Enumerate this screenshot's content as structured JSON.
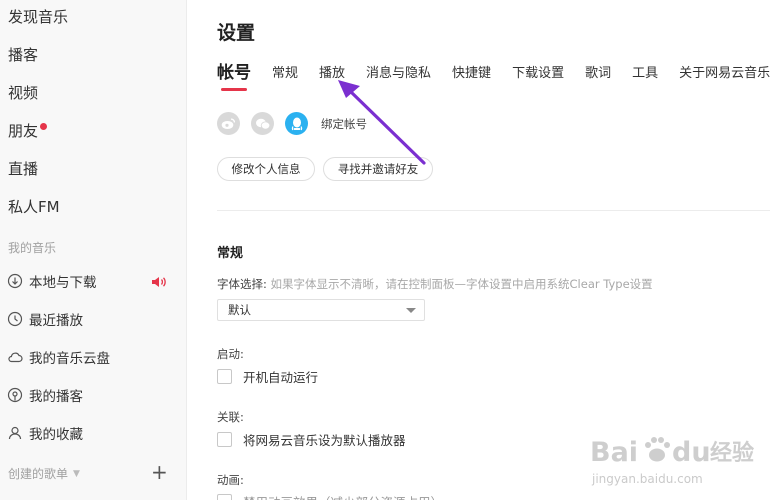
{
  "sidebar": {
    "nav": [
      {
        "label": "发现音乐"
      },
      {
        "label": "播客"
      },
      {
        "label": "视频"
      },
      {
        "label": "朋友",
        "badge_color": "#e5354a"
      },
      {
        "label": "直播"
      },
      {
        "label": "私人FM"
      }
    ],
    "my_music_title": "我的音乐",
    "my_music": [
      {
        "label": "本地与下载",
        "icon": "download-icon",
        "playing_icon": "speaker-icon"
      },
      {
        "label": "最近播放",
        "icon": "clock-icon"
      },
      {
        "label": "我的音乐云盘",
        "icon": "cloud-icon"
      },
      {
        "label": "我的播客",
        "icon": "podcast-icon"
      },
      {
        "label": "我的收藏",
        "icon": "user-icon"
      }
    ],
    "created_playlists_title": "创建的歌单",
    "add_symbol": "+"
  },
  "settings": {
    "title": "设置",
    "tabs": [
      {
        "label": "帐号",
        "active": true
      },
      {
        "label": "常规"
      },
      {
        "label": "播放"
      },
      {
        "label": "消息与隐私"
      },
      {
        "label": "快捷键"
      },
      {
        "label": "下载设置"
      },
      {
        "label": "歌词"
      },
      {
        "label": "工具"
      },
      {
        "label": "关于网易云音乐"
      }
    ],
    "account": {
      "social_icons": [
        "weibo-icon",
        "wechat-icon",
        "qq-icon"
      ],
      "bind_label": "绑定帐号",
      "edit_profile": "修改个人信息",
      "find_friends": "寻找并邀请好友"
    },
    "general": {
      "title": "常规",
      "font_label": "字体选择:",
      "font_hint": "如果字体显示不清晰，请在控制面板—字体设置中启用系统Clear Type设置",
      "font_value": "默认",
      "startup_label": "启动:",
      "startup_option": "开机自动运行",
      "assoc_label": "关联:",
      "assoc_option": "将网易云音乐设为默认播放器",
      "anim_label": "动画:",
      "anim_option": "禁用动画效果（减少部分资源占用）"
    }
  },
  "annotation": {
    "color": "#7b2fd0",
    "target": "播放"
  },
  "watermark": {
    "brand_a": "Bai",
    "brand_b": "du",
    "cn": "经验",
    "url": "jingyan.baidu.com"
  },
  "colors": {
    "accent": "#e5354a",
    "qq": "#2bb1f0",
    "sidebar_bg": "#f8f8f8"
  }
}
